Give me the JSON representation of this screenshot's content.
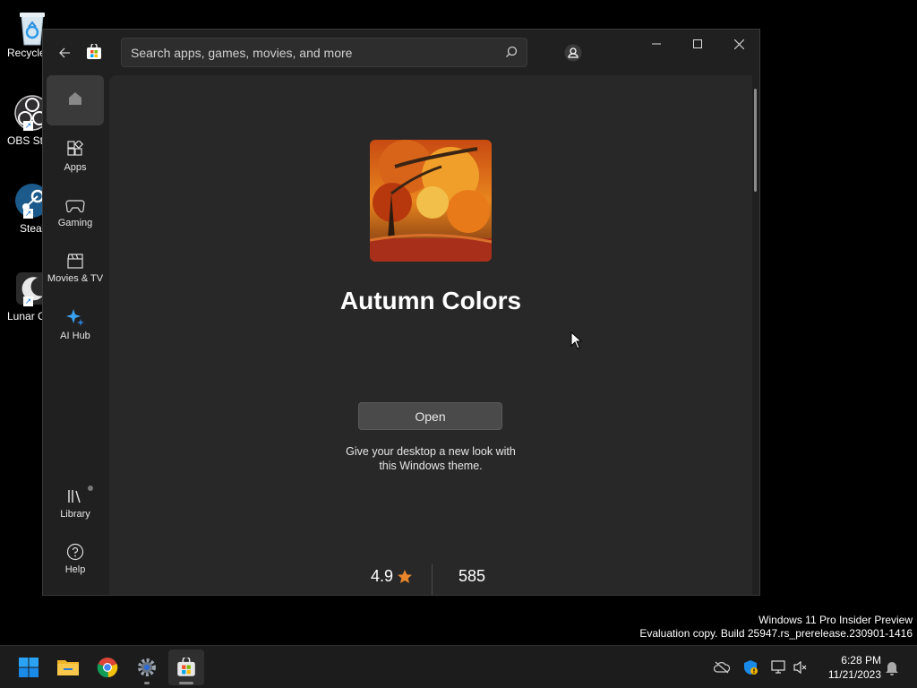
{
  "desktop": {
    "icons": [
      {
        "label": "Recycle"
      },
      {
        "label": "OBS Stu"
      },
      {
        "label": "Steam"
      },
      {
        "label": "Lunar C"
      }
    ]
  },
  "store": {
    "search_placeholder": "Search apps, games, movies, and more",
    "nav": {
      "home": "Home",
      "apps": "Apps",
      "gaming": "Gaming",
      "movies": "Movies & TV",
      "ai_hub": "AI Hub",
      "library": "Library",
      "help": "Help"
    },
    "product": {
      "title": "Autumn Colors",
      "open_label": "Open",
      "description": "Give your desktop a new look with this Windows theme.",
      "rating": "4.9",
      "ratings_count": "585"
    }
  },
  "watermark": {
    "line1": "Windows 11 Pro Insider Preview",
    "line2": "Evaluation copy. Build 25947.rs_prerelease.230901-1416"
  },
  "clock": {
    "time": "6:28 PM",
    "date": "11/21/2023"
  },
  "colors": {
    "accent": "#0078d4",
    "star": "#e8862c"
  }
}
